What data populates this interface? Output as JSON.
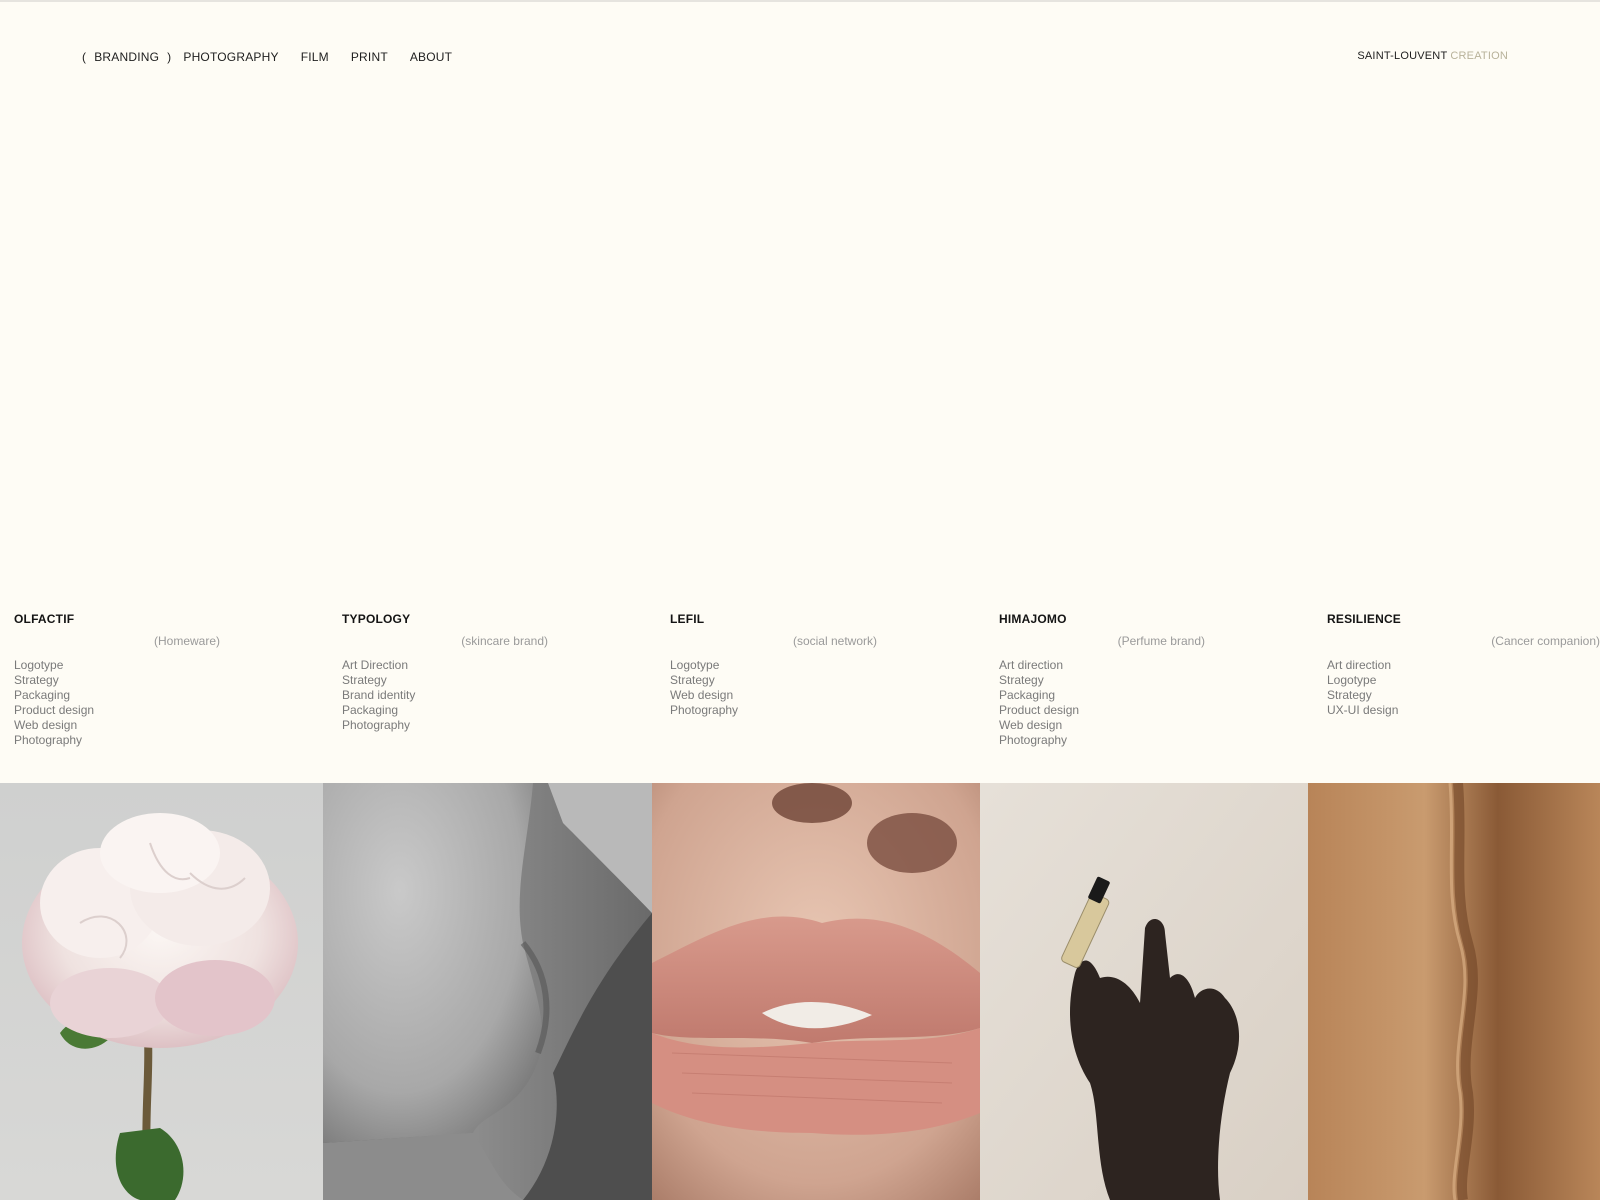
{
  "nav": {
    "items": [
      {
        "label": "BRANDING",
        "active": true
      },
      {
        "label": "PHOTOGRAPHY",
        "active": false
      },
      {
        "label": "FILM",
        "active": false
      },
      {
        "label": "PRINT",
        "active": false
      },
      {
        "label": "ABOUT",
        "active": false
      }
    ],
    "paren_open": "(",
    "paren_close": ")"
  },
  "brand": {
    "name": "SAINT-LOUVENT",
    "suffix": "CREATION"
  },
  "projects": [
    {
      "name": "OLFACTIF",
      "category": "(Homeware)",
      "services": [
        "Logotype",
        "Strategy",
        "Packaging",
        "Product design",
        "Web design",
        "Photography"
      ],
      "image": "peony-flower"
    },
    {
      "name": "TYPOLOGY",
      "category": "(skincare brand)",
      "services": [
        "Art Direction",
        "Strategy",
        "Brand identity",
        "Packaging",
        "Photography"
      ],
      "image": "black-and-white-skin"
    },
    {
      "name": "LEFIL",
      "category": "(social network)",
      "services": [
        "Logotype",
        "Strategy",
        "Web design",
        "Photography"
      ],
      "image": "lips-closeup"
    },
    {
      "name": "HIMAJOMO",
      "category": "(Perfume brand)",
      "services": [
        "Art direction",
        "Strategy",
        "Packaging",
        "Product design",
        "Web design",
        "Photography"
      ],
      "image": "hand-holding-perfume-vial"
    },
    {
      "name": "RESILIENCE",
      "category": "(Cancer companion)",
      "services": [
        "Art direction",
        "Logotype",
        "Strategy",
        "UX-UI design"
      ],
      "image": "skin-scar-closeup"
    }
  ],
  "colors": {
    "background": "#FEFCF5",
    "text": "#1e1e1e",
    "muted": "#9a9a9a",
    "accent": "#b8b29a"
  }
}
